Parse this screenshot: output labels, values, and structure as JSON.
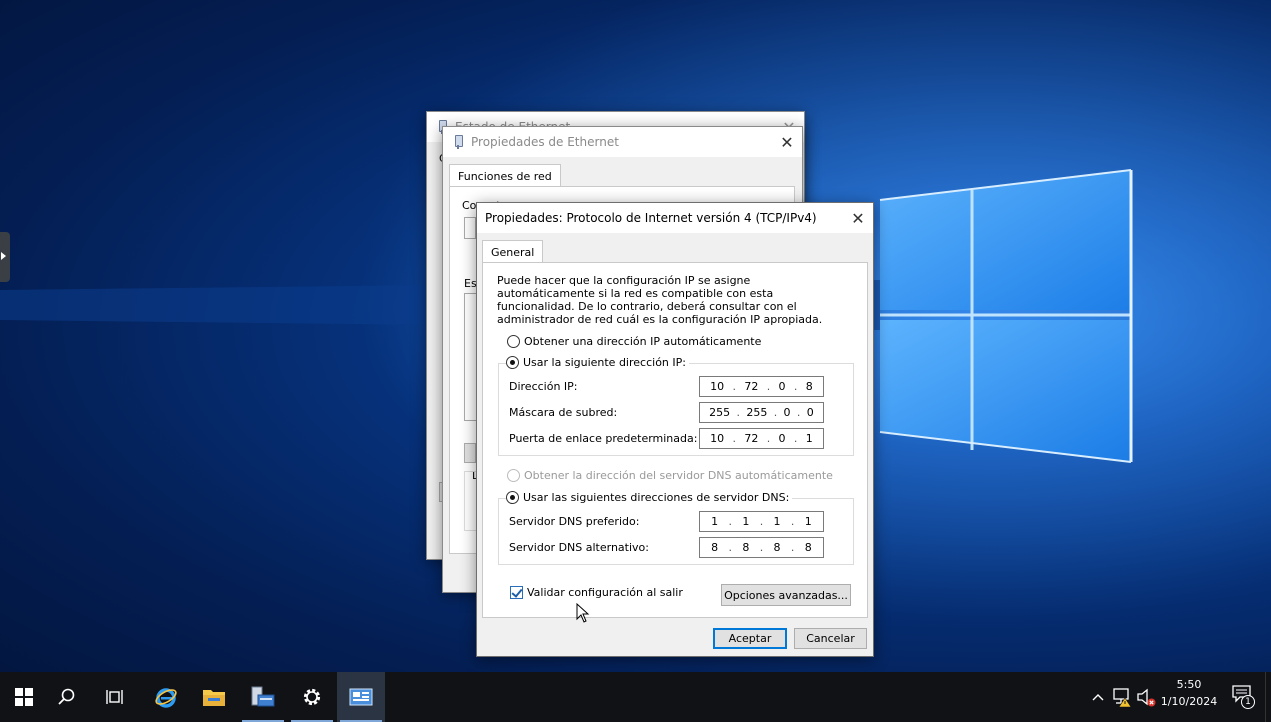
{
  "windows": {
    "estado": {
      "title": "Estado de Ethernet",
      "close": "✕",
      "partial_labels": [
        "C"
      ]
    },
    "propiedades_ethernet": {
      "title": "Propiedades de Ethernet",
      "close": "✕",
      "tab": "Funciones de red",
      "connect_label": "Conectar con:",
      "list_label": "Es",
      "partial_label": "D"
    },
    "ipv4": {
      "title": "Propiedades: Protocolo de Internet versión 4 (TCP/IPv4)",
      "close": "✕",
      "tab": "General",
      "description": "Puede hacer que la configuración IP se asigne automáticamente si la red es compatible con esta funcionalidad. De lo contrario, deberá consultar con el administrador de red cuál es la configuración IP apropiada.",
      "radio_auto_ip": "Obtener una dirección IP automáticamente",
      "radio_manual_ip": "Usar la siguiente dirección IP:",
      "ip_label": "Dirección IP:",
      "ip_value": [
        "10",
        "72",
        "0",
        "8"
      ],
      "mask_label": "Máscara de subred:",
      "mask_value": [
        "255",
        "255",
        "0",
        "0"
      ],
      "gateway_label": "Puerta de enlace predeterminada:",
      "gateway_value": [
        "10",
        "72",
        "0",
        "1"
      ],
      "radio_auto_dns": "Obtener la dirección del servidor DNS automáticamente",
      "radio_manual_dns": "Usar las siguientes direcciones de servidor DNS:",
      "dns_pref_label": "Servidor DNS preferido:",
      "dns_pref_value": [
        "1",
        "1",
        "1",
        "1"
      ],
      "dns_alt_label": "Servidor DNS alternativo:",
      "dns_alt_value": [
        "8",
        "8",
        "8",
        "8"
      ],
      "validate_label": "Validar configuración al salir",
      "validate_checked": true,
      "advanced_button": "Opciones avanzadas...",
      "ok_button": "Aceptar",
      "cancel_button": "Cancelar"
    }
  },
  "taskbar": {
    "items": [
      "start-icon",
      "search-icon",
      "task-view-icon",
      "internet-explorer-icon",
      "file-explorer-icon",
      "server-manager-icon",
      "settings-icon",
      "network-connections-icon"
    ],
    "time": "5:50",
    "date": "1/10/2024",
    "notification_count": "1"
  },
  "colors": {
    "accent": "#0078d7",
    "taskbar": "#101216",
    "wallpaper": "#0d4aa8"
  }
}
